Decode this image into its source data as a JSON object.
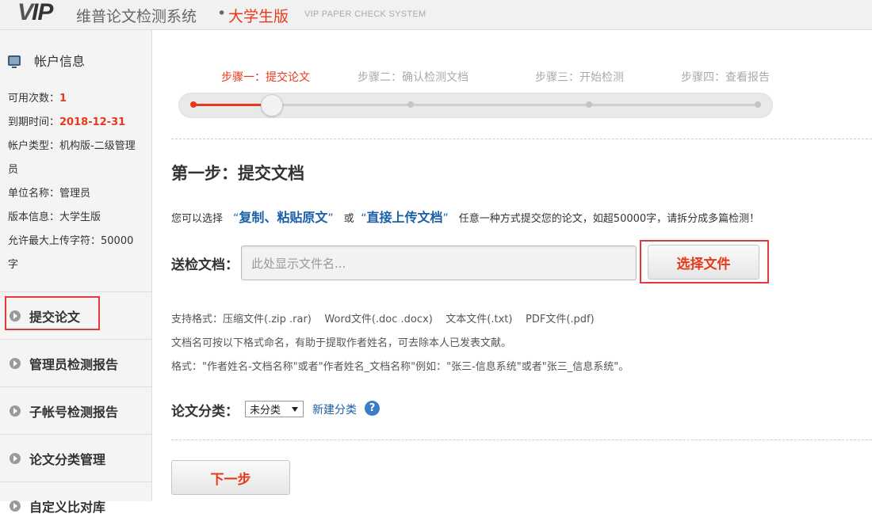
{
  "header": {
    "logo_v": "V",
    "logo_ip": "IP",
    "site_name": "维普论文检测系统",
    "separator": "•",
    "edition": "大学生版",
    "english_title": "VIP PAPER CHECK SYSTEM"
  },
  "account": {
    "title": "帐户信息",
    "rows": [
      {
        "label": "可用次数：",
        "value": "1"
      },
      {
        "label": "到期时间：",
        "value": "2018-12-31"
      },
      {
        "text": "帐户类型：机构版-二级管理员"
      },
      {
        "text": "单位名称：管理员"
      },
      {
        "text": "版本信息：大学生版"
      },
      {
        "text": "允许最大上传字符：50000字"
      }
    ]
  },
  "nav": [
    {
      "label": "提交论文"
    },
    {
      "label": "管理员检测报告"
    },
    {
      "label": "子帐号检测报告"
    },
    {
      "label": "论文分类管理"
    },
    {
      "label": "自定义比对库"
    }
  ],
  "steps": [
    {
      "label": "步骤一：提交论文",
      "active": true
    },
    {
      "label": "步骤二：确认检测文档",
      "active": false
    },
    {
      "label": "步骤三：开始检测",
      "active": false
    },
    {
      "label": "步骤四：查看报告",
      "active": false
    }
  ],
  "progress": {
    "current_step": 1,
    "total_steps": 4
  },
  "main": {
    "title": "第一步：提交文档",
    "desc_prefix": "您可以选择",
    "option1": "复制、粘贴原文",
    "desc_or": "或",
    "option2": "直接上传文档",
    "desc_suffix": "任意一种方式提交您的论文，如超50000字，请拆分成多篇检测！",
    "file_label": "送检文档：",
    "file_placeholder": "此处显示文件名...",
    "choose_button": "选择文件",
    "formats": "支持格式：压缩文件(.zip .rar)    Word文件(.doc .docx)    文本文件(.txt)    PDF文件(.pdf)",
    "naming_tip": "文档名可按以下格式命名，有助于提取作者姓名，可去除本人已发表文献。",
    "naming_example": "格式：\"作者姓名-文档名称\"或者\"作者姓名_文档名称\"例如：\"张三-信息系统\"或者\"张三_信息系统\"。",
    "category_label": "论文分类：",
    "category_selected": "未分类",
    "new_category": "新建分类",
    "help_symbol": "?",
    "next_button": "下一步"
  },
  "colors": {
    "accent": "#e8391a",
    "link": "#1a5fa8",
    "highlight_box": "#e23a3a"
  },
  "icons": {
    "account": "monitor-icon",
    "nav": "play-circle-icon",
    "help": "help-icon"
  }
}
